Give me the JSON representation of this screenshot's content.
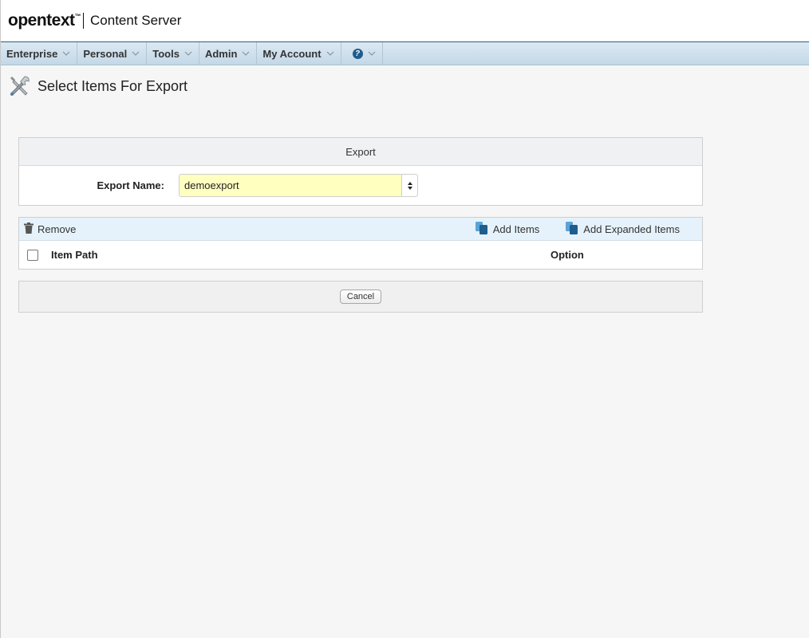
{
  "header": {
    "logo_text": "opentext",
    "logo_tm": "™",
    "product": "Content Server"
  },
  "nav": {
    "items": [
      {
        "label": "Enterprise"
      },
      {
        "label": "Personal"
      },
      {
        "label": "Tools"
      },
      {
        "label": "Admin"
      },
      {
        "label": "My Account"
      }
    ],
    "help_glyph": "?"
  },
  "page": {
    "title": "Select Items For Export",
    "title_icon": "tools-icon"
  },
  "export": {
    "section_title": "Export",
    "name_label": "Export Name:",
    "name_value": "demoexport"
  },
  "items": {
    "toolbar": {
      "remove": "Remove",
      "add_items": "Add Items",
      "add_expanded_items": "Add Expanded Items"
    },
    "columns": {
      "path": "Item Path",
      "option": "Option"
    }
  },
  "actions": {
    "cancel": "Cancel"
  },
  "colors": {
    "accent": "#1f5d8d",
    "field_highlight": "#ffffc0",
    "toolbar_bg": "#e6f2fb"
  }
}
